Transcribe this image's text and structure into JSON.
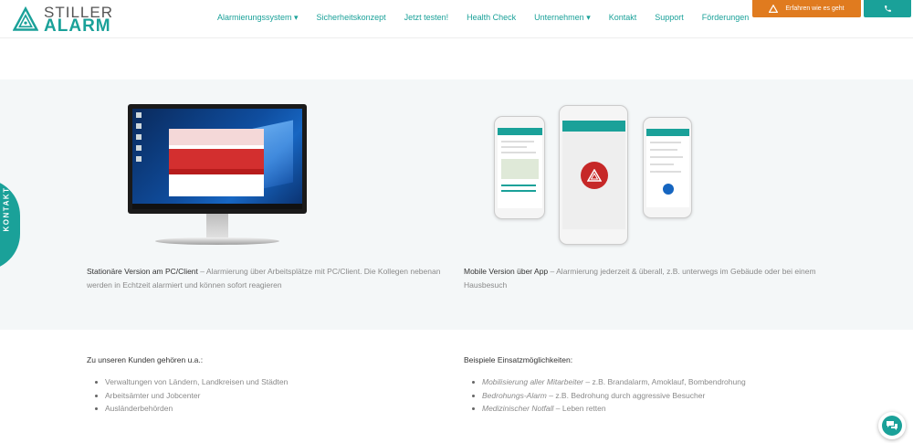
{
  "header": {
    "logo_line1": "STILLER",
    "logo_line2": "ALARM",
    "nav": [
      {
        "label": "Alarmierungssystem ▾"
      },
      {
        "label": "Sicherheitskonzept"
      },
      {
        "label": "Jetzt testen!"
      },
      {
        "label": "Health Check"
      },
      {
        "label": "Unternehmen ▾"
      },
      {
        "label": "Kontakt"
      },
      {
        "label": "Support"
      },
      {
        "label": "Förderungen"
      }
    ],
    "learn_button": "Erfahren wie es geht",
    "phone_icon": "phone-icon"
  },
  "side_tab": {
    "label": "KONTAKT"
  },
  "showcase": {
    "left_title": "Stationäre Version am PC/Client",
    "left_text": " – Alarmierung über Arbeitsplätze mit PC/Client. Die Kollegen nebenan werden in Echtzeit alarmiert und können sofort reagieren",
    "right_title": "Mobile Version über App",
    "right_text": " – Alarmierung jederzeit & überall, z.B. unterwegs im Gebäude oder bei einem Hausbesuch"
  },
  "customers": {
    "title": "Zu unseren Kunden gehören u.a.:",
    "items": [
      "Verwaltungen von Ländern, Landkreisen und Städten",
      "Arbeitsämter und Jobcenter",
      "Ausländerbehörden"
    ]
  },
  "examples": {
    "title": "Beispiele Einsatzmöglichkeiten:",
    "items": [
      {
        "em": "Mobilisierung aller Mitarbeiter",
        "rest": " – z.B. Brandalarm, Amoklauf, Bombendrohung"
      },
      {
        "em": "Bedrohungs-Alarm",
        "rest": " – z.B. Bedrohung durch aggressive Besucher"
      },
      {
        "em": "Medizinischer Notfall",
        "rest": " – Leben retten"
      }
    ]
  },
  "colors": {
    "brand": "#1aa199",
    "accent": "#e07b1f",
    "alarm": "#c62828"
  },
  "chat_icon": "chat-bubbles-icon"
}
